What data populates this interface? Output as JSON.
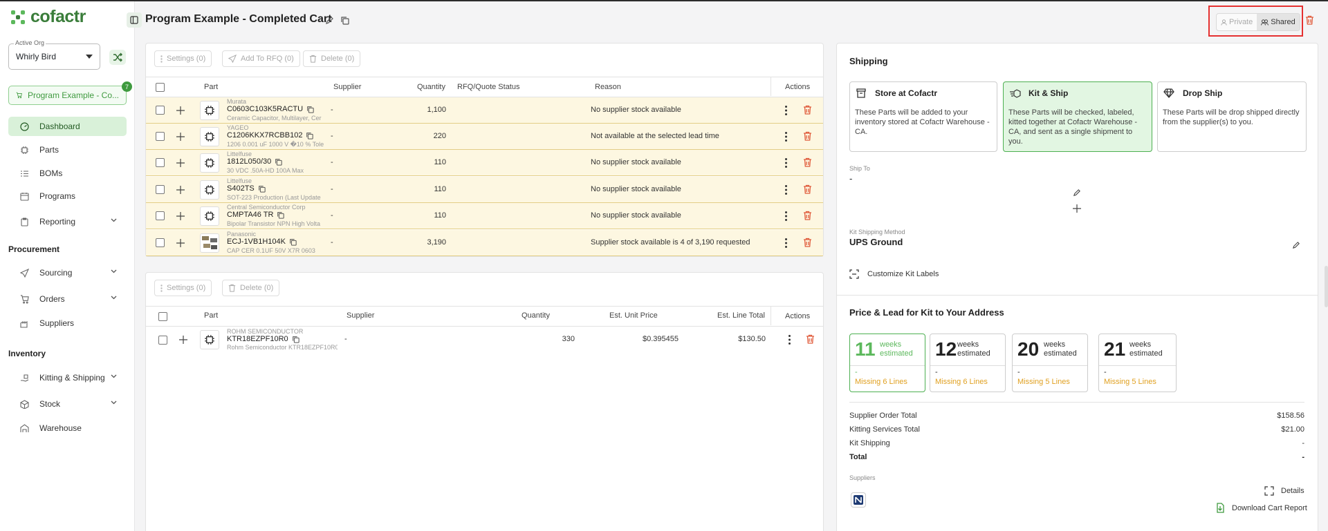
{
  "app": {
    "logo": "cofactr"
  },
  "sidebar": {
    "org_label": "Active Org",
    "org_value": "Whirly Bird",
    "cart_button": "Program Example - Co...",
    "cart_badge": "7",
    "nav": [
      {
        "label": "Dashboard"
      },
      {
        "label": "Parts"
      },
      {
        "label": "BOMs"
      },
      {
        "label": "Programs"
      },
      {
        "label": "Reporting"
      }
    ],
    "procurement_heading": "Procurement",
    "procurement": [
      {
        "label": "Sourcing"
      },
      {
        "label": "Orders"
      },
      {
        "label": "Suppliers"
      }
    ],
    "inventory_heading": "Inventory",
    "inventory": [
      {
        "label": "Kitting & Shipping"
      },
      {
        "label": "Stock"
      },
      {
        "label": "Warehouse"
      }
    ]
  },
  "header": {
    "title": "Program Example - Completed Cart",
    "private_label": "Private",
    "shared_label": "Shared"
  },
  "table1": {
    "toolbar": {
      "settings": "Settings (0)",
      "rfq": "Add To RFQ (0)",
      "delete": "Delete (0)"
    },
    "columns": {
      "part": "Part",
      "supplier": "Supplier",
      "quantity": "Quantity",
      "status": "RFQ/Quote Status",
      "reason": "Reason",
      "actions": "Actions"
    },
    "rows": [
      {
        "mfr": "Murata",
        "pn": "C0603C103K5RACTU",
        "desc": "Ceramic Capacitor, Multilayer, Cer",
        "supplier": "-",
        "qty": "1,100",
        "reason": "No supplier stock available"
      },
      {
        "mfr": "YAGEO",
        "pn": "C1206KKX7RCBB102",
        "desc": "1206 0.001 uF 1000 V �10 % Tole",
        "supplier": "-",
        "qty": "220",
        "reason": "Not available at the selected lead time"
      },
      {
        "mfr": "Littelfuse",
        "pn": "1812L050/30",
        "desc": "30 VDC .50A-HD 100A Max",
        "supplier": "-",
        "qty": "110",
        "reason": "No supplier stock available"
      },
      {
        "mfr": "Littelfuse",
        "pn": "S402TS",
        "desc": "SOT-223 Production (Last Update",
        "supplier": "-",
        "qty": "110",
        "reason": "No supplier stock available"
      },
      {
        "mfr": "Central Semiconductor Corp",
        "pn": "CMPTA46 TR",
        "desc": "Bipolar Transistor NPN High Volta",
        "supplier": "-",
        "qty": "110",
        "reason": "No supplier stock available"
      },
      {
        "mfr": "Panasonic",
        "pn": "ECJ-1VB1H104K",
        "desc": "CAP CER 0.1UF 50V X7R 0603",
        "supplier": "-",
        "qty": "3,190",
        "reason": "Supplier stock available is 4 of 3,190 requested"
      }
    ]
  },
  "table2": {
    "toolbar": {
      "settings": "Settings (0)",
      "delete": "Delete (0)"
    },
    "columns": {
      "part": "Part",
      "supplier": "Supplier",
      "quantity": "Quantity",
      "unit_price": "Est. Unit Price",
      "line_total": "Est. Line Total",
      "actions": "Actions"
    },
    "rows": [
      {
        "mfr": "ROHM SEMICONDUCTOR",
        "pn": "KTR18EZPF10R0",
        "desc": "Rohm Semiconductor KTR18EZPF10R0",
        "supplier": "-",
        "qty": "330",
        "unit_price": "$0.395455",
        "line_total": "$130.50"
      }
    ]
  },
  "shipping": {
    "heading": "Shipping",
    "options": [
      {
        "title": "Store at Cofactr",
        "desc": "These Parts will be added to your inventory stored at Cofactr Warehouse - CA."
      },
      {
        "title": "Kit & Ship",
        "desc": "These Parts will be checked, labeled, kitted together at Cofactr Warehouse - CA, and sent as a single shipment to you."
      },
      {
        "title": "Drop Ship",
        "desc": "These Parts will be drop shipped directly from the supplier(s) to you."
      }
    ],
    "ship_to_label": "Ship To",
    "ship_to_value": "-",
    "method_label": "Kit Shipping Method",
    "method_value": "UPS Ground",
    "customize_label": "Customize Kit Labels"
  },
  "lead": {
    "heading": "Price & Lead for Kit to Your Address",
    "cards": [
      {
        "weeks": "11",
        "unit": "weeks estimated",
        "dash": "-",
        "missing": "Missing 6 Lines"
      },
      {
        "weeks": "12",
        "unit": "weeks estimated",
        "dash": "-",
        "missing": "Missing 6 Lines"
      },
      {
        "weeks": "20",
        "unit": "weeks estimated",
        "dash": "-",
        "missing": "Missing 5 Lines"
      },
      {
        "weeks": "21",
        "unit": "weeks estimated",
        "dash": "-",
        "missing": "Missing 5 Lines"
      }
    ],
    "totals": [
      {
        "label": "Supplier Order Total",
        "value": "$158.56"
      },
      {
        "label": "Kitting Services Total",
        "value": "$21.00"
      },
      {
        "label": "Kit Shipping",
        "value": "-"
      },
      {
        "label": "Total",
        "value": "-"
      }
    ],
    "suppliers_label": "Suppliers",
    "details_label": "Details",
    "download_label": "Download Cart Report"
  },
  "colors": {
    "brand": "#3a7d3a",
    "accent_green": "#5cb85c",
    "warn": "#e0a020",
    "danger": "#e05a3a",
    "row_bg": "#fdf7e1"
  }
}
